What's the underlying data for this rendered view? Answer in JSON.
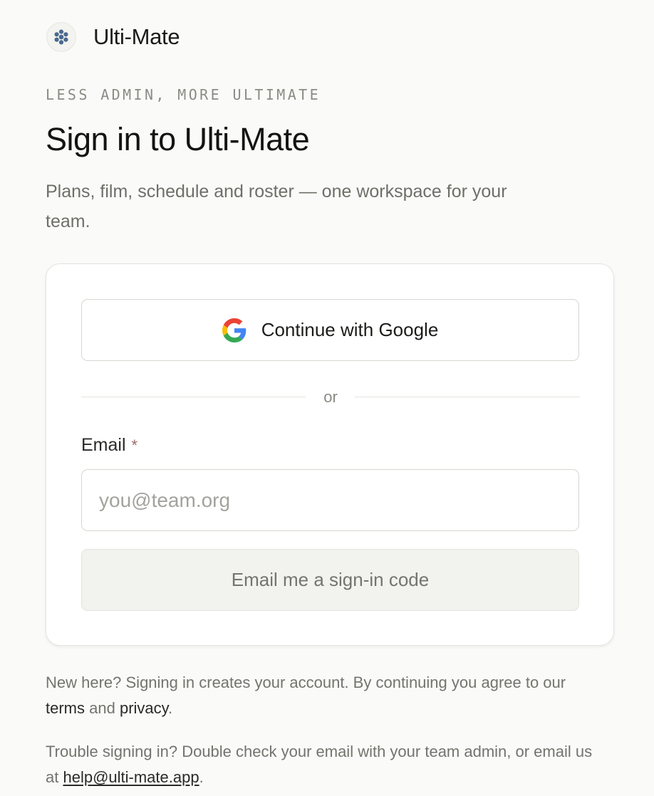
{
  "brand": {
    "name": "Ulti-Mate",
    "logo_icon": "disc-flower-logo",
    "logo_color": "#4a6a8e"
  },
  "hero": {
    "eyebrow": "LESS ADMIN, MORE ULTIMATE",
    "title": "Sign in to Ulti-Mate",
    "subtitle": "Plans, film, schedule and roster — one workspace for your team."
  },
  "auth": {
    "google_button_label": "Continue with Google",
    "google_icon": "google-g-icon",
    "divider_text": "or",
    "email_label": "Email",
    "required_marker": "*",
    "email_placeholder": "you@team.org",
    "email_value": "",
    "submit_label": "Email me a sign-in code"
  },
  "footer": {
    "terms_prefix": "New here? Signing in creates your account. By continuing you agree to our",
    "terms_link": "terms",
    "and_text": "and",
    "privacy_link": "privacy",
    "period": ".",
    "trouble_text": "Trouble signing in? Double check your email with your team admin, or email us at",
    "help_email": "help@ulti-mate.app",
    "trouble_period": "."
  },
  "colors": {
    "background": "#fafaf8",
    "card": "#ffffff",
    "accent_required": "#a06a63",
    "muted_text": "#74746e"
  }
}
